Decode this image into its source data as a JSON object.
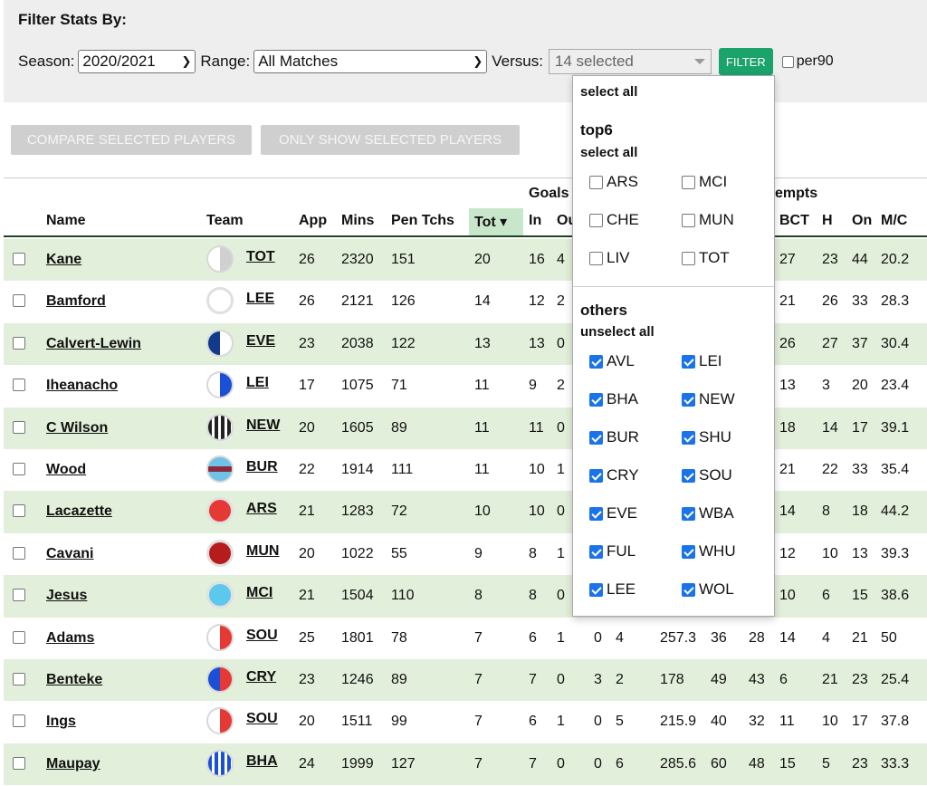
{
  "filter": {
    "title": "Filter Stats By:",
    "season_label": "Season:",
    "season_value": "2020/2021",
    "range_label": "Range:",
    "range_value": "All Matches",
    "versus_label": "Versus:",
    "versus_value": "14 selected",
    "filter_button": "FILTER",
    "per90_label": "per90"
  },
  "actions": {
    "compare": "COMPARE SELECTED PLAYERS",
    "only_show": "ONLY SHOW SELECTED PLAYERS"
  },
  "table": {
    "group_headers": {
      "goals": "Goals",
      "attempts": "empts"
    },
    "headers": {
      "name": "Name",
      "team": "Team",
      "app": "App",
      "mins": "Mins",
      "pen_tchs": "Pen Tchs",
      "tot": "Tot",
      "in": "In",
      "out": "Ou",
      "bct": "BCT",
      "h": "H",
      "on": "On",
      "mc": "M/C"
    },
    "sort_indicator": "▾",
    "rows": [
      {
        "name": "Kane",
        "team": "TOT",
        "app": "26",
        "mins": "2320",
        "pen": "151",
        "tot": "20",
        "in": "16",
        "out": "4",
        "c9": "",
        "c10": "",
        "c11": "",
        "c12": "",
        "c13": "",
        "bct": "27",
        "h": "23",
        "on": "44",
        "mc": "20.2",
        "colors": [
          "#ffffff",
          "#d0d0d0"
        ],
        "style": "half"
      },
      {
        "name": "Bamford",
        "team": "LEE",
        "app": "26",
        "mins": "2121",
        "pen": "126",
        "tot": "14",
        "in": "12",
        "out": "2",
        "c9": "",
        "c10": "",
        "c11": "",
        "c12": "",
        "c13": "",
        "bct": "21",
        "h": "26",
        "on": "33",
        "mc": "28.3",
        "colors": [
          "#ffffff",
          "#ffffff"
        ],
        "style": "solid"
      },
      {
        "name": "Calvert-Lewin",
        "team": "EVE",
        "app": "23",
        "mins": "2038",
        "pen": "122",
        "tot": "13",
        "in": "13",
        "out": "0",
        "c9": "",
        "c10": "",
        "c11": "",
        "c12": "",
        "c13": "",
        "bct": "26",
        "h": "27",
        "on": "37",
        "mc": "30.4",
        "colors": [
          "#123a8c",
          "#ffffff"
        ],
        "style": "half"
      },
      {
        "name": "Iheanacho",
        "team": "LEI",
        "app": "17",
        "mins": "1075",
        "pen": "71",
        "tot": "11",
        "in": "9",
        "out": "2",
        "c9": "",
        "c10": "",
        "c11": "",
        "c12": "",
        "c13": "",
        "bct": "13",
        "h": "3",
        "on": "20",
        "mc": "23.4",
        "colors": [
          "#ffffff",
          "#1a4fd6"
        ],
        "style": "half"
      },
      {
        "name": "C Wilson",
        "team": "NEW",
        "app": "20",
        "mins": "1605",
        "pen": "89",
        "tot": "11",
        "in": "11",
        "out": "0",
        "c9": "",
        "c10": "",
        "c11": "",
        "c12": "",
        "c13": "",
        "bct": "18",
        "h": "14",
        "on": "17",
        "mc": "39.1",
        "colors": [
          "#222222",
          "#ffffff"
        ],
        "style": "stripes"
      },
      {
        "name": "Wood",
        "team": "BUR",
        "app": "22",
        "mins": "1914",
        "pen": "111",
        "tot": "11",
        "in": "10",
        "out": "1",
        "c9": "",
        "c10": "",
        "c11": "",
        "c12": "",
        "c13": "",
        "bct": "21",
        "h": "22",
        "on": "33",
        "mc": "35.4",
        "colors": [
          "#8b2a3f",
          "#6ec3e6"
        ],
        "style": "band"
      },
      {
        "name": "Lacazette",
        "team": "ARS",
        "app": "21",
        "mins": "1283",
        "pen": "72",
        "tot": "10",
        "in": "10",
        "out": "0",
        "c9": "",
        "c10": "",
        "c11": "",
        "c12": "",
        "c13": "",
        "bct": "14",
        "h": "8",
        "on": "18",
        "mc": "44.2",
        "colors": [
          "#e53935",
          "#e53935"
        ],
        "style": "solid"
      },
      {
        "name": "Cavani",
        "team": "MUN",
        "app": "20",
        "mins": "1022",
        "pen": "55",
        "tot": "9",
        "in": "8",
        "out": "1",
        "c9": "",
        "c10": "",
        "c11": "",
        "c12": "",
        "c13": "",
        "bct": "12",
        "h": "10",
        "on": "13",
        "mc": "39.3",
        "colors": [
          "#b71c1c",
          "#b71c1c"
        ],
        "style": "solid"
      },
      {
        "name": "Jesus",
        "team": "MCI",
        "app": "21",
        "mins": "1504",
        "pen": "110",
        "tot": "8",
        "in": "8",
        "out": "0",
        "c9": "",
        "c10": "",
        "c11": "",
        "c12": "",
        "c13": "",
        "bct": "10",
        "h": "6",
        "on": "15",
        "mc": "38.6",
        "colors": [
          "#5bc8ec",
          "#5bc8ec"
        ],
        "style": "solid"
      },
      {
        "name": "Adams",
        "team": "SOU",
        "app": "25",
        "mins": "1801",
        "pen": "78",
        "tot": "7",
        "in": "6",
        "out": "1",
        "c9": "0",
        "c10": "4",
        "c11": "257.3",
        "c12": "36",
        "c13": "28",
        "bct": "14",
        "h": "4",
        "on": "21",
        "mc": "50",
        "colors": [
          "#ffffff",
          "#e53935"
        ],
        "style": "half"
      },
      {
        "name": "Benteke",
        "team": "CRY",
        "app": "23",
        "mins": "1246",
        "pen": "89",
        "tot": "7",
        "in": "7",
        "out": "0",
        "c9": "3",
        "c10": "2",
        "c11": "178",
        "c12": "49",
        "c13": "43",
        "bct": "6",
        "h": "21",
        "on": "23",
        "mc": "25.4",
        "colors": [
          "#1a4fd6",
          "#e53935"
        ],
        "style": "half"
      },
      {
        "name": "Ings",
        "team": "SOU",
        "app": "20",
        "mins": "1511",
        "pen": "99",
        "tot": "7",
        "in": "6",
        "out": "1",
        "c9": "0",
        "c10": "5",
        "c11": "215.9",
        "c12": "40",
        "c13": "32",
        "bct": "11",
        "h": "10",
        "on": "17",
        "mc": "37.8",
        "colors": [
          "#ffffff",
          "#e53935"
        ],
        "style": "half"
      },
      {
        "name": "Maupay",
        "team": "BHA",
        "app": "24",
        "mins": "1999",
        "pen": "127",
        "tot": "7",
        "in": "7",
        "out": "0",
        "c9": "0",
        "c10": "6",
        "c11": "285.6",
        "c12": "60",
        "c13": "48",
        "bct": "15",
        "h": "5",
        "on": "23",
        "mc": "33.3",
        "colors": [
          "#1a4fd6",
          "#ffffff"
        ],
        "style": "stripes"
      }
    ]
  },
  "dropdown": {
    "select_all": "select all",
    "top6_label": "top6",
    "top6_action": "select all",
    "top6_items": [
      {
        "label": "ARS",
        "checked": false
      },
      {
        "label": "MCI",
        "checked": false
      },
      {
        "label": "CHE",
        "checked": false
      },
      {
        "label": "MUN",
        "checked": false
      },
      {
        "label": "LIV",
        "checked": false
      },
      {
        "label": "TOT",
        "checked": false
      }
    ],
    "others_label": "others",
    "others_action": "unselect all",
    "others_items": [
      {
        "label": "AVL",
        "checked": true
      },
      {
        "label": "LEI",
        "checked": true
      },
      {
        "label": "BHA",
        "checked": true
      },
      {
        "label": "NEW",
        "checked": true
      },
      {
        "label": "BUR",
        "checked": true
      },
      {
        "label": "SHU",
        "checked": true
      },
      {
        "label": "CRY",
        "checked": true
      },
      {
        "label": "SOU",
        "checked": true
      },
      {
        "label": "EVE",
        "checked": true
      },
      {
        "label": "WBA",
        "checked": true
      },
      {
        "label": "FUL",
        "checked": true
      },
      {
        "label": "WHU",
        "checked": true
      },
      {
        "label": "LEE",
        "checked": true
      },
      {
        "label": "WOL",
        "checked": true
      }
    ]
  }
}
